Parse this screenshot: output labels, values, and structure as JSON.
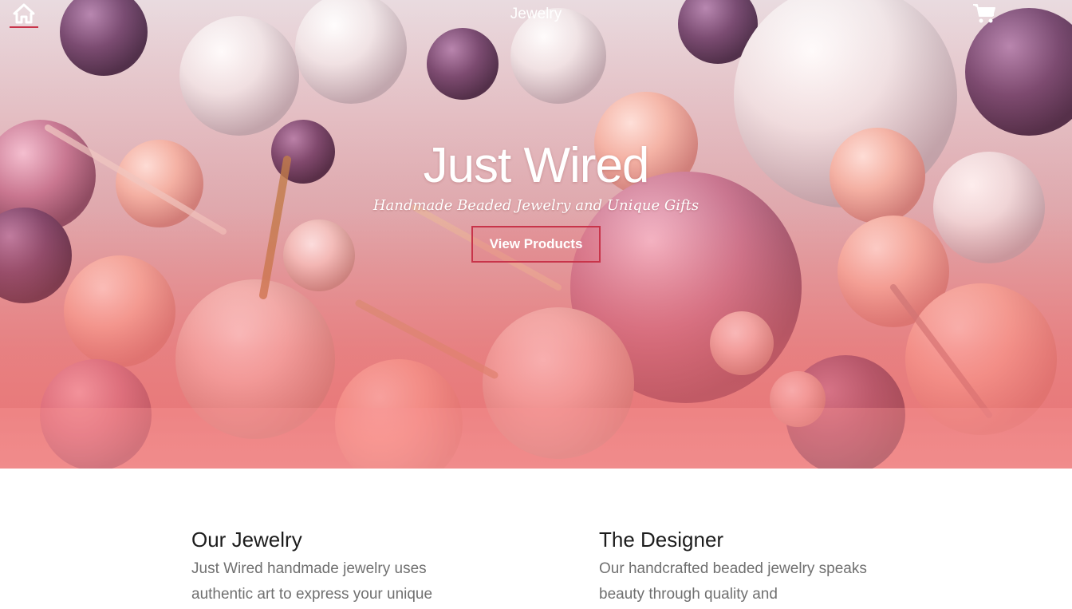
{
  "nav": {
    "home_icon": "home-icon",
    "title": "Jewelry",
    "cart_icon": "cart-icon"
  },
  "hero": {
    "title": "Just Wired",
    "subtitle": "Handmade Beaded Jewelry and Unique Gifts",
    "button_label": "View Products"
  },
  "sections": [
    {
      "heading": "Our Jewelry",
      "text": "Just Wired handmade jewelry uses authentic art to express your unique"
    },
    {
      "heading": "The Designer",
      "text": "Our handcrafted beaded jewelry speaks beauty through quality and"
    }
  ],
  "colors": {
    "accent": "#c8344a",
    "hero_overlay": "#f27a7a",
    "heading_text": "#1c1c1c",
    "body_text": "#707070"
  }
}
